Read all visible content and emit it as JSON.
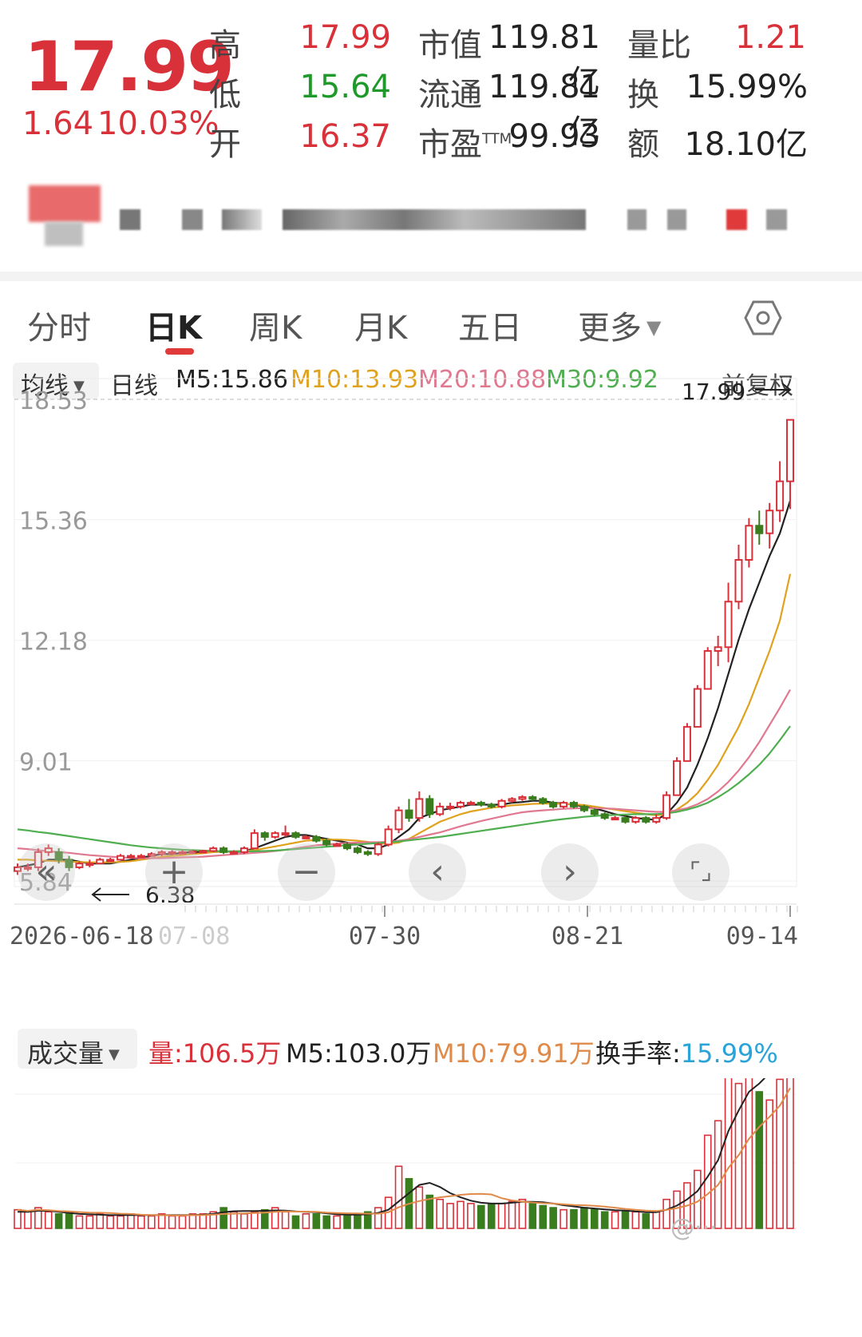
{
  "quote": {
    "price": "17.99",
    "change": "1.64",
    "change_pct": "10.03%",
    "high_label": "高",
    "high": "17.99",
    "low_label": "低",
    "low": "15.64",
    "open_label": "开",
    "open": "16.37",
    "mcap_label": "市值",
    "mcap": "119.81亿",
    "float_label": "流通",
    "float": "119.81亿",
    "pe_label": "市盈",
    "pe_sup": "TTM",
    "pe": "99.93",
    "vr_label": "量比",
    "vr": "1.21",
    "turnover_label": "换",
    "turnover": "15.99%",
    "amount_label": "额",
    "amount": "18.10亿"
  },
  "tabs": [
    {
      "label": "分时"
    },
    {
      "label": "日K"
    },
    {
      "label": "周K"
    },
    {
      "label": "月K"
    },
    {
      "label": "五日"
    },
    {
      "label": "更多"
    }
  ],
  "active_tab": "日K",
  "settings_icon": "hexagon-gear-icon",
  "ma_bar": {
    "selector": "均线",
    "period": "日线",
    "m5": "M5:15.86",
    "m10": "M10:13.93",
    "m20": "M20:10.88",
    "m30": "M30:9.92",
    "adjust": "前复权"
  },
  "colors": {
    "up": "#d9313a",
    "down": "#3a7d1f",
    "m5": "#222222",
    "m10": "#e0a21e",
    "m20": "#e07890",
    "m30": "#4fae4f",
    "turnover": "#2aa3d8"
  },
  "vol_bar": {
    "selector": "成交量",
    "vol_label": "量:",
    "vol_value": "106.5万",
    "m5": "M5:103.0万",
    "m10": "M10:79.91万",
    "turn_label": "换手率:",
    "turn_value": "15.99%"
  },
  "chart_data": {
    "type": "candlestick",
    "y_ticks": [
      "18.53",
      "15.36",
      "12.18",
      "9.01",
      "5.84"
    ],
    "y_tick_values": [
      18.53,
      15.36,
      12.18,
      9.01,
      5.84
    ],
    "ylim": [
      5.84,
      18.53
    ],
    "x_labels": [
      "2026-06-18",
      "07-08",
      "07-30",
      "08-21",
      "09-14"
    ],
    "annotation_high": "17.99",
    "annotation_low": "6.38",
    "candles": [
      [
        6.1,
        6.2,
        6.0,
        6.3
      ],
      [
        6.2,
        6.2,
        6.1,
        6.3
      ],
      [
        6.2,
        6.6,
        6.1,
        6.7
      ],
      [
        6.6,
        6.7,
        6.5,
        6.8
      ],
      [
        6.6,
        6.4,
        6.3,
        6.7
      ],
      [
        6.4,
        6.2,
        6.1,
        6.5
      ],
      [
        6.2,
        6.3,
        6.15,
        6.35
      ],
      [
        6.3,
        6.3,
        6.2,
        6.4
      ],
      [
        6.3,
        6.4,
        6.3,
        6.45
      ],
      [
        6.4,
        6.4,
        6.35,
        6.45
      ],
      [
        6.4,
        6.5,
        6.4,
        6.55
      ],
      [
        6.5,
        6.5,
        6.45,
        6.55
      ],
      [
        6.5,
        6.5,
        6.45,
        6.55
      ],
      [
        6.5,
        6.55,
        6.5,
        6.6
      ],
      [
        6.55,
        6.6,
        6.5,
        6.65
      ],
      [
        6.6,
        6.6,
        6.55,
        6.65
      ],
      [
        6.6,
        6.6,
        6.55,
        6.65
      ],
      [
        6.6,
        6.62,
        6.55,
        6.65
      ],
      [
        6.62,
        6.63,
        6.58,
        6.66
      ],
      [
        6.63,
        6.7,
        6.6,
        6.75
      ],
      [
        6.7,
        6.6,
        6.55,
        6.75
      ],
      [
        6.6,
        6.6,
        6.55,
        6.65
      ],
      [
        6.6,
        6.7,
        6.55,
        6.75
      ],
      [
        6.7,
        7.1,
        6.7,
        7.2
      ],
      [
        7.1,
        7.0,
        6.9,
        7.15
      ],
      [
        7.0,
        7.1,
        6.95,
        7.15
      ],
      [
        7.1,
        7.1,
        7.0,
        7.3
      ],
      [
        7.1,
        7.0,
        6.95,
        7.15
      ],
      [
        7.0,
        7.0,
        6.95,
        7.05
      ],
      [
        7.0,
        6.9,
        6.85,
        7.05
      ],
      [
        6.9,
        6.8,
        6.75,
        6.95
      ],
      [
        6.8,
        6.8,
        6.75,
        6.85
      ],
      [
        6.8,
        6.7,
        6.65,
        6.85
      ],
      [
        6.7,
        6.6,
        6.55,
        6.75
      ],
      [
        6.6,
        6.55,
        6.5,
        6.65
      ],
      [
        6.55,
        6.8,
        6.5,
        6.85
      ],
      [
        6.8,
        7.2,
        6.75,
        7.3
      ],
      [
        7.2,
        7.7,
        7.1,
        7.8
      ],
      [
        7.7,
        7.5,
        7.4,
        8.0
      ],
      [
        7.5,
        8.0,
        7.4,
        8.2
      ],
      [
        8.0,
        7.6,
        7.5,
        8.1
      ],
      [
        7.6,
        7.8,
        7.55,
        7.9
      ],
      [
        7.8,
        7.8,
        7.7,
        7.9
      ],
      [
        7.8,
        7.9,
        7.75,
        7.95
      ],
      [
        7.9,
        7.9,
        7.85,
        7.95
      ],
      [
        7.9,
        7.85,
        7.8,
        7.95
      ],
      [
        7.85,
        7.8,
        7.75,
        7.9
      ],
      [
        7.8,
        7.95,
        7.75,
        8.0
      ],
      [
        7.95,
        8.0,
        7.9,
        8.05
      ],
      [
        8.0,
        8.05,
        7.95,
        8.1
      ],
      [
        8.05,
        8.0,
        7.95,
        8.1
      ],
      [
        8.0,
        7.9,
        7.85,
        8.05
      ],
      [
        7.9,
        7.8,
        7.75,
        7.95
      ],
      [
        7.8,
        7.9,
        7.75,
        7.95
      ],
      [
        7.9,
        7.8,
        7.75,
        7.95
      ],
      [
        7.8,
        7.7,
        7.65,
        7.85
      ],
      [
        7.7,
        7.6,
        7.55,
        7.75
      ],
      [
        7.6,
        7.5,
        7.45,
        7.65
      ],
      [
        7.5,
        7.5,
        7.45,
        7.55
      ],
      [
        7.5,
        7.4,
        7.35,
        7.55
      ],
      [
        7.4,
        7.5,
        7.35,
        7.55
      ],
      [
        7.5,
        7.4,
        7.35,
        7.55
      ],
      [
        7.4,
        7.5,
        7.35,
        7.6
      ],
      [
        7.5,
        8.1,
        7.45,
        8.2
      ],
      [
        8.1,
        9.0,
        8.1,
        9.1
      ],
      [
        9.0,
        9.9,
        9.0,
        10.0
      ],
      [
        9.9,
        10.9,
        9.9,
        11.0
      ],
      [
        10.9,
        11.9,
        10.9,
        12.0
      ],
      [
        11.9,
        12.0,
        11.5,
        12.3
      ],
      [
        12.0,
        13.2,
        11.6,
        13.7
      ],
      [
        13.2,
        14.3,
        13.0,
        14.7
      ],
      [
        14.3,
        15.2,
        14.1,
        15.4
      ],
      [
        15.2,
        15.0,
        14.7,
        15.6
      ],
      [
        15.0,
        15.6,
        14.6,
        15.8
      ],
      [
        15.6,
        16.37,
        15.3,
        16.9
      ],
      [
        16.37,
        17.99,
        15.64,
        17.99
      ]
    ],
    "ma_series": [
      {
        "name": "M5",
        "color": "#222222",
        "values": [
          6.2,
          6.25,
          6.3,
          6.4,
          6.4,
          6.4,
          6.35,
          6.3,
          6.3,
          6.3,
          6.35,
          6.4,
          6.45,
          6.5,
          6.55,
          6.55,
          6.58,
          6.6,
          6.6,
          6.62,
          6.62,
          6.6,
          6.62,
          6.7,
          6.8,
          6.9,
          7.0,
          7.05,
          7.05,
          7.0,
          6.95,
          6.9,
          6.85,
          6.8,
          6.7,
          6.7,
          6.8,
          7.0,
          7.2,
          7.5,
          7.6,
          7.7,
          7.75,
          7.8,
          7.85,
          7.85,
          7.85,
          7.85,
          7.9,
          7.92,
          7.95,
          7.95,
          7.9,
          7.88,
          7.85,
          7.8,
          7.75,
          7.68,
          7.6,
          7.55,
          7.5,
          7.47,
          7.45,
          7.6,
          7.9,
          8.3,
          8.9,
          9.6,
          10.4,
          11.3,
          12.2,
          13.0,
          13.7,
          14.4,
          15.0,
          15.86
        ]
      },
      {
        "name": "M10",
        "color": "#e0a21e",
        "values": [
          6.4,
          6.4,
          6.38,
          6.37,
          6.36,
          6.35,
          6.34,
          6.33,
          6.33,
          6.33,
          6.34,
          6.36,
          6.4,
          6.44,
          6.48,
          6.5,
          6.52,
          6.55,
          6.57,
          6.6,
          6.61,
          6.62,
          6.63,
          6.65,
          6.7,
          6.75,
          6.8,
          6.85,
          6.9,
          6.92,
          6.93,
          6.93,
          6.92,
          6.9,
          6.87,
          6.83,
          6.82,
          6.85,
          6.95,
          7.1,
          7.25,
          7.4,
          7.5,
          7.6,
          7.67,
          7.72,
          7.77,
          7.8,
          7.83,
          7.85,
          7.87,
          7.88,
          7.88,
          7.87,
          7.86,
          7.84,
          7.8,
          7.76,
          7.72,
          7.68,
          7.64,
          7.6,
          7.57,
          7.6,
          7.72,
          7.9,
          8.15,
          8.5,
          8.9,
          9.4,
          9.9,
          10.5,
          11.2,
          11.9,
          12.7,
          13.93
        ]
      },
      {
        "name": "M20",
        "color": "#e07890",
        "values": [
          6.7,
          6.68,
          6.65,
          6.62,
          6.6,
          6.58,
          6.55,
          6.52,
          6.5,
          6.48,
          6.46,
          6.45,
          6.44,
          6.44,
          6.44,
          6.45,
          6.46,
          6.47,
          6.48,
          6.5,
          6.52,
          6.54,
          6.56,
          6.58,
          6.6,
          6.63,
          6.66,
          6.7,
          6.74,
          6.78,
          6.8,
          6.82,
          6.84,
          6.85,
          6.86,
          6.86,
          6.87,
          6.9,
          6.94,
          7.0,
          7.06,
          7.12,
          7.2,
          7.28,
          7.35,
          7.42,
          7.48,
          7.54,
          7.6,
          7.65,
          7.68,
          7.7,
          7.72,
          7.74,
          7.75,
          7.76,
          7.76,
          7.75,
          7.74,
          7.72,
          7.7,
          7.68,
          7.66,
          7.66,
          7.7,
          7.76,
          7.86,
          8.0,
          8.2,
          8.45,
          8.75,
          9.1,
          9.5,
          9.95,
          10.4,
          10.88
        ]
      },
      {
        "name": "M30",
        "color": "#4fae4f",
        "values": [
          7.2,
          7.17,
          7.13,
          7.1,
          7.06,
          7.02,
          6.98,
          6.94,
          6.9,
          6.86,
          6.82,
          6.78,
          6.75,
          6.72,
          6.7,
          6.68,
          6.66,
          6.65,
          6.64,
          6.63,
          6.62,
          6.62,
          6.62,
          6.62,
          6.63,
          6.64,
          6.66,
          6.68,
          6.7,
          6.72,
          6.74,
          6.76,
          6.78,
          6.8,
          6.82,
          6.84,
          6.86,
          6.88,
          6.91,
          6.94,
          6.97,
          7.0,
          7.04,
          7.08,
          7.12,
          7.16,
          7.2,
          7.24,
          7.28,
          7.32,
          7.36,
          7.4,
          7.44,
          7.47,
          7.5,
          7.53,
          7.55,
          7.57,
          7.58,
          7.59,
          7.6,
          7.6,
          7.6,
          7.62,
          7.66,
          7.72,
          7.8,
          7.9,
          8.05,
          8.22,
          8.42,
          8.65,
          8.9,
          9.2,
          9.55,
          9.92
        ]
      }
    ],
    "volume": [
      9,
      8,
      10,
      8,
      7,
      7,
      6,
      6,
      7,
      6,
      6,
      7,
      6,
      6,
      7,
      6,
      6,
      7,
      7,
      8,
      10,
      8,
      7,
      8,
      9,
      10,
      8,
      6,
      7,
      7,
      6,
      6,
      6,
      7,
      8,
      10,
      15,
      30,
      24,
      20,
      16,
      14,
      12,
      13,
      12,
      11,
      12,
      12,
      13,
      14,
      12,
      11,
      10,
      9,
      9,
      10,
      9,
      8,
      8,
      8,
      8,
      7,
      8,
      14,
      18,
      22,
      28,
      45,
      52,
      90,
      70,
      86,
      66,
      62,
      72,
      106.5
    ],
    "volume_ma5": [
      8,
      8,
      8.5,
      8.5,
      8,
      7.5,
      7,
      6.8,
      6.6,
      6.4,
      6.4,
      6.4,
      6.4,
      6.4,
      6.4,
      6.4,
      6.4,
      6.5,
      6.6,
      7,
      7.8,
      8.3,
      8.4,
      8.4,
      8.5,
      8.7,
      8.6,
      8.2,
      8,
      7.8,
      7.3,
      6.8,
      6.6,
      6.6,
      6.8,
      7.5,
      9,
      13,
      17,
      21,
      22,
      20,
      17,
      15,
      13.4,
      12.4,
      12,
      12,
      12.4,
      12.8,
      12.8,
      12.6,
      12,
      11.2,
      10.6,
      10,
      9.6,
      9.2,
      8.8,
      8.6,
      8.2,
      7.8,
      7.8,
      9,
      11,
      14,
      18,
      25,
      33,
      47,
      57,
      66,
      70,
      75,
      76,
      103
    ]
  }
}
